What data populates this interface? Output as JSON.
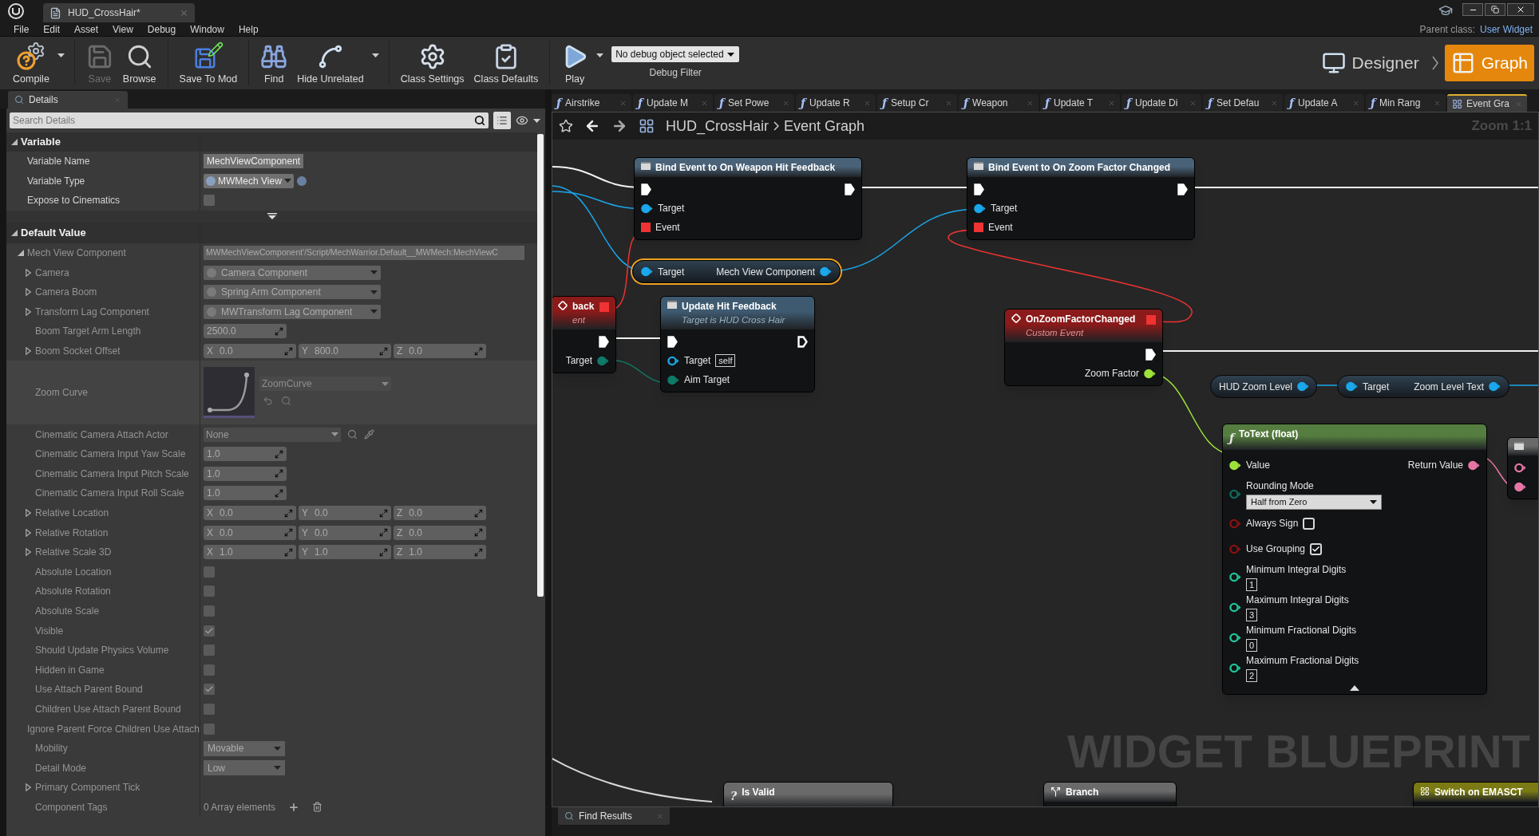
{
  "window": {
    "tab_title": "HUD_CrossHair*",
    "parent_class_label": "Parent class:",
    "parent_class": "User Widget"
  },
  "menu": [
    "File",
    "Edit",
    "Asset",
    "View",
    "Debug",
    "Window",
    "Help"
  ],
  "toolbar": [
    {
      "kind": "compile",
      "label": "Compile",
      "disabled": false,
      "dropdown": true
    },
    {
      "kind": "save",
      "label": "Save",
      "disabled": true,
      "dropdown": false
    },
    {
      "kind": "browse",
      "label": "Browse",
      "disabled": false,
      "dropdown": false
    },
    {
      "kind": "save_to_mod",
      "label": "Save To Mod",
      "disabled": false,
      "dropdown": false
    },
    {
      "kind": "find",
      "label": "Find",
      "disabled": false,
      "dropdown": false
    },
    {
      "kind": "hide_unrelated",
      "label": "Hide Unrelated",
      "disabled": false,
      "dropdown": true
    },
    {
      "kind": "class_settings",
      "label": "Class Settings",
      "disabled": false,
      "dropdown": false
    },
    {
      "kind": "class_defaults",
      "label": "Class Defaults",
      "disabled": false,
      "dropdown": false
    },
    {
      "kind": "play",
      "label": "Play",
      "disabled": false,
      "dropdown": true
    }
  ],
  "debug_filter": {
    "value": "No debug object selected",
    "label": "Debug Filter"
  },
  "modes": [
    {
      "label": "Designer",
      "selected": false
    },
    {
      "label": "Graph",
      "selected": true
    }
  ],
  "details": {
    "tab": "Details",
    "search_placeholder": "Search Details",
    "sections": [
      {
        "title": "Variable",
        "expanded": true,
        "read_only": false,
        "rows": [
          {
            "label": "Variable Name",
            "kind": "text",
            "value": "MechViewComponent"
          },
          {
            "label": "Variable Type",
            "kind": "type",
            "value": "MWMech View"
          },
          {
            "label": "Expose to Cinematics",
            "kind": "checkbox",
            "checked": false
          }
        ]
      },
      {
        "title": "Default Value",
        "expanded": true,
        "read_only": true,
        "rows": [
          {
            "label": "Mech View Component",
            "kind": "path",
            "value": "MWMechViewComponent'/Script/MechWarrior.Default__MWMech:MechViewC",
            "expanded": true,
            "children": [
              {
                "label": "Camera",
                "kind": "combo",
                "value": "Camera Component",
                "expanded": false
              },
              {
                "label": "Camera Boom",
                "kind": "combo",
                "value": "Spring Arm Component",
                "expanded": false
              },
              {
                "label": "Transform Lag Component",
                "kind": "combo",
                "value": "MWTransform Lag Component",
                "expanded": false
              },
              {
                "label": "Boom Target Arm Length",
                "kind": "number",
                "value": "2500.0"
              },
              {
                "label": "Boom Socket Offset",
                "kind": "vector",
                "expanded": false,
                "values": [
                  {
                    "axis": "X",
                    "value": "0.0"
                  },
                  {
                    "axis": "Y",
                    "value": "800.0"
                  },
                  {
                    "axis": "Z",
                    "value": "0.0"
                  }
                ]
              },
              {
                "label": "Zoom Curve",
                "kind": "curve",
                "value": "ZoomCurve"
              },
              {
                "label": "Cinematic Camera Attach Actor",
                "kind": "actor",
                "value": "None"
              },
              {
                "label": "Cinematic Camera Input Yaw Scale",
                "kind": "number",
                "value": "1.0"
              },
              {
                "label": "Cinematic Camera Input Pitch Scale",
                "kind": "number",
                "value": "1.0"
              },
              {
                "label": "Cinematic Camera Input Roll Scale",
                "kind": "number",
                "value": "1.0"
              },
              {
                "label": "Relative Location",
                "kind": "vector",
                "expanded": false,
                "values": [
                  {
                    "axis": "X",
                    "value": "0.0"
                  },
                  {
                    "axis": "Y",
                    "value": "0.0"
                  },
                  {
                    "axis": "Z",
                    "value": "0.0"
                  }
                ]
              },
              {
                "label": "Relative Rotation",
                "kind": "vector",
                "expanded": false,
                "values": [
                  {
                    "axis": "X",
                    "value": "0.0"
                  },
                  {
                    "axis": "Y",
                    "value": "0.0"
                  },
                  {
                    "axis": "Z",
                    "value": "0.0"
                  }
                ]
              },
              {
                "label": "Relative Scale 3D",
                "kind": "vector",
                "expanded": false,
                "values": [
                  {
                    "axis": "X",
                    "value": "1.0"
                  },
                  {
                    "axis": "Y",
                    "value": "1.0"
                  },
                  {
                    "axis": "Z",
                    "value": "1.0"
                  }
                ]
              },
              {
                "label": "Absolute Location",
                "kind": "checkbox",
                "checked": false
              },
              {
                "label": "Absolute Rotation",
                "kind": "checkbox",
                "checked": false
              },
              {
                "label": "Absolute Scale",
                "kind": "checkbox",
                "checked": false
              },
              {
                "label": "Visible",
                "kind": "checkbox",
                "checked": true
              },
              {
                "label": "Should Update Physics Volume",
                "kind": "checkbox",
                "checked": false
              },
              {
                "label": "Hidden in Game",
                "kind": "checkbox",
                "checked": false
              },
              {
                "label": "Use Attach Parent Bound",
                "kind": "checkbox",
                "checked": true
              },
              {
                "label": "Children Use Attach Parent Bound",
                "kind": "checkbox",
                "checked": false
              },
              {
                "label": "Ignore Parent Force Children Use Attach",
                "kind": "checkbox",
                "checked": false
              },
              {
                "label": "Mobility",
                "kind": "enum",
                "value": "Movable"
              },
              {
                "label": "Detail Mode",
                "kind": "enum",
                "value": "Low"
              },
              {
                "label": "Primary Component Tick",
                "kind": "none",
                "expanded": false
              },
              {
                "label": "Component Tags",
                "kind": "array",
                "value": "0 Array elements"
              }
            ]
          }
        ]
      }
    ]
  },
  "graph_tabs": [
    {
      "kind": "function",
      "icon": "ƒ",
      "label": "Airstrike",
      "selected": false
    },
    {
      "kind": "function",
      "icon": "ƒ",
      "label": "Update M",
      "selected": false
    },
    {
      "kind": "function",
      "icon": "ƒ",
      "label": "Set Powe",
      "selected": false
    },
    {
      "kind": "function",
      "icon": "ƒ",
      "label": "Update R",
      "selected": false
    },
    {
      "kind": "function",
      "icon": "ƒ",
      "label": "Setup Cr",
      "selected": false
    },
    {
      "kind": "function",
      "icon": "ƒ",
      "label": "Weapon",
      "selected": false
    },
    {
      "kind": "function",
      "icon": "ƒ",
      "label": "Update T",
      "selected": false
    },
    {
      "kind": "function",
      "icon": "ƒ",
      "label": "Update Di",
      "selected": false
    },
    {
      "kind": "function",
      "icon": "ƒ",
      "label": "Set Defau",
      "selected": false
    },
    {
      "kind": "function",
      "icon": "ƒ",
      "label": "Update A",
      "selected": false
    },
    {
      "kind": "function",
      "icon": "ƒ",
      "label": "Min Rang",
      "selected": false
    },
    {
      "kind": "graph",
      "label": "Event Gra",
      "selected": true
    }
  ],
  "breadcrumb": [
    "HUD_CrossHair",
    "Event Graph"
  ],
  "zoom": "Zoom 1:1",
  "graph_type_label": "WIDGET BLUEPRINT",
  "nodes": [
    {
      "kind": "call",
      "title": "Bind Event to On Weapon Hit Feedback",
      "color": "#4a6278",
      "rows": [
        {
          "in": {
            "kind": "exec",
            "color": "#ffffff",
            "connected": true
          },
          "out": {
            "kind": "exec",
            "color": "#ffffff",
            "connected": true
          }
        },
        {
          "in": {
            "label": "Target",
            "kind": "data",
            "color": "#1aa7ec",
            "connected": true
          }
        },
        {
          "in": {
            "label": "Event",
            "kind": "delegate",
            "color": "#ee3333",
            "connected": true
          }
        }
      ]
    },
    {
      "kind": "call",
      "title": "Bind Event to On Zoom Factor Changed",
      "color": "#4a6278",
      "rows": [
        {
          "in": {
            "kind": "exec",
            "color": "#ffffff",
            "connected": true
          },
          "out": {
            "kind": "exec",
            "color": "#ffffff",
            "connected": true
          }
        },
        {
          "in": {
            "label": "Target",
            "kind": "data",
            "color": "#1aa7ec",
            "connected": true
          }
        },
        {
          "in": {
            "label": "Event",
            "kind": "delegate",
            "color": "#ee3333",
            "connected": true
          }
        }
      ]
    },
    {
      "kind": "pill",
      "selected": true,
      "rows": [
        {
          "in": {
            "label": "Target",
            "kind": "data",
            "color": "#1aa7ec",
            "connected": true
          },
          "out": {
            "label": "Mech View Component",
            "kind": "data",
            "color": "#1aa7ec",
            "connected": true
          }
        }
      ]
    },
    {
      "kind": "event",
      "title": "back",
      "subtitle": "ent",
      "color": "#8b1a1a",
      "header_pin": {
        "kind": "delegate",
        "color": "#ee3333",
        "connected": true
      },
      "rows": [
        {
          "out": {
            "kind": "exec",
            "color": "#ffffff",
            "connected": true
          }
        },
        {
          "out": {
            "label": "Target",
            "kind": "data",
            "color": "#0f7a68",
            "connected": true
          }
        }
      ]
    },
    {
      "kind": "call",
      "title": "Update Hit Feedback",
      "subtitle": "Target is HUD Cross Hair",
      "color": "#3e5a70",
      "rows": [
        {
          "in": {
            "kind": "exec",
            "color": "#ffffff",
            "connected": true
          },
          "out": {
            "kind": "exec",
            "color": "#ffffff",
            "connected": false
          }
        },
        {
          "in": {
            "label": "Target",
            "kind": "data",
            "color": "#1aa7ec",
            "connected": false,
            "field": {
              "kind": "inline",
              "value": "self"
            }
          }
        },
        {
          "in": {
            "label": "Aim Target",
            "kind": "data",
            "color": "#0f7a68",
            "connected": true
          }
        }
      ]
    },
    {
      "kind": "event",
      "title": "OnZoomFactorChanged",
      "subtitle": "Custom Event",
      "color": "#8b1a1a",
      "header_pin": {
        "kind": "delegate",
        "color": "#ee3333",
        "connected": true
      },
      "rows": [
        {
          "out": {
            "kind": "exec",
            "color": "#ffffff",
            "connected": true
          }
        },
        {
          "out": {
            "label": "Zoom Factor",
            "kind": "data",
            "color": "#9ee33a",
            "connected": true
          }
        }
      ]
    },
    {
      "kind": "pill",
      "selected": false,
      "rows": [
        {
          "out": {
            "label": "HUD Zoom Level",
            "kind": "data",
            "color": "#1aa7ec",
            "connected": true
          }
        }
      ]
    },
    {
      "kind": "pill",
      "selected": false,
      "rows": [
        {
          "in": {
            "label": "Target",
            "kind": "data",
            "color": "#1aa7ec",
            "connected": true
          },
          "out": {
            "label": "Zoom Level Text",
            "kind": "data",
            "color": "#1aa7ec",
            "connected": true
          }
        }
      ]
    },
    {
      "kind": "function",
      "icon": "ƒ",
      "title": "ToText (float)",
      "color": "#557d3f",
      "rows": [
        {
          "in": {
            "label": "Value",
            "kind": "data",
            "color": "#9ee33a",
            "connected": true
          },
          "out": {
            "label": "Return Value",
            "kind": "data",
            "color": "#e676a6",
            "connected": true
          }
        },
        {
          "in": {
            "label": "Rounding Mode",
            "kind": "data",
            "color": "#0f6b5e",
            "connected": false,
            "field": {
              "kind": "combo",
              "value": "Half from Zero"
            }
          }
        },
        {
          "in": {
            "label": "Always Sign",
            "kind": "data",
            "color": "#8a1010",
            "connected": false,
            "field": {
              "kind": "checkbox",
              "checked": false
            }
          }
        },
        {
          "in": {
            "label": "Use Grouping",
            "kind": "data",
            "color": "#8a1010",
            "connected": false,
            "field": {
              "kind": "checkbox",
              "checked": true
            }
          }
        },
        {
          "in": {
            "label": "Minimum Integral Digits",
            "kind": "data",
            "color": "#1ec59a",
            "connected": false,
            "field": {
              "kind": "stacked",
              "value": "1"
            }
          }
        },
        {
          "in": {
            "label": "Maximum Integral Digits",
            "kind": "data",
            "color": "#1ec59a",
            "connected": false,
            "field": {
              "kind": "stacked",
              "value": "3"
            }
          }
        },
        {
          "in": {
            "label": "Minimum Fractional Digits",
            "kind": "data",
            "color": "#1ec59a",
            "connected": false,
            "field": {
              "kind": "stacked",
              "value": "0"
            }
          }
        },
        {
          "in": {
            "label": "Maximum Fractional Digits",
            "kind": "data",
            "color": "#1ec59a",
            "connected": false,
            "field": {
              "kind": "stacked",
              "value": "2"
            }
          }
        }
      ]
    },
    {
      "kind": "call",
      "color": "#6a6a6a",
      "rows": [
        {
          "in": {
            "kind": "data",
            "color": "#e676a6",
            "connected": false
          }
        },
        {
          "in": {
            "kind": "data",
            "color": "#e676a6",
            "connected": true
          }
        }
      ]
    },
    {
      "kind": "macro",
      "icon": "?",
      "title": "Is Valid",
      "color": "#6a6a6a"
    },
    {
      "kind": "branch",
      "title": "Branch",
      "color": "#6a6a6a"
    },
    {
      "kind": "switch",
      "title": "Switch on EMASCT",
      "color": "#7b7a14"
    }
  ],
  "bottom_tab": "Find Results"
}
